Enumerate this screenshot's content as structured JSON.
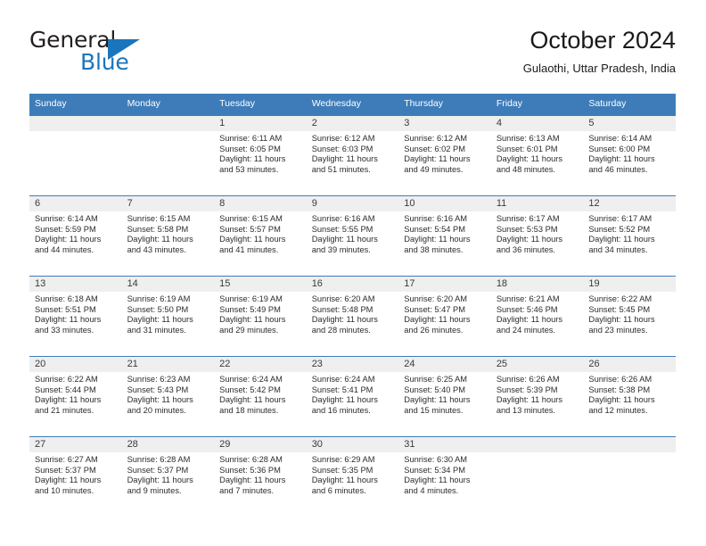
{
  "brand": {
    "name_part1": "General",
    "name_part2": "Blue",
    "accent_color": "#1b75bc"
  },
  "header": {
    "title": "October 2024",
    "subtitle": "Gulaothi, Uttar Pradesh, India"
  },
  "calendar": {
    "header_color": "#3e7cb9",
    "daynum_band_color": "#efefef",
    "weekday_headers": [
      "Sunday",
      "Monday",
      "Tuesday",
      "Wednesday",
      "Thursday",
      "Friday",
      "Saturday"
    ],
    "weeks": [
      [
        {
          "day": "",
          "sunrise": "",
          "sunset": "",
          "daylight_line1": "",
          "daylight_line2": ""
        },
        {
          "day": "",
          "sunrise": "",
          "sunset": "",
          "daylight_line1": "",
          "daylight_line2": ""
        },
        {
          "day": "1",
          "sunrise": "Sunrise: 6:11 AM",
          "sunset": "Sunset: 6:05 PM",
          "daylight_line1": "Daylight: 11 hours",
          "daylight_line2": "and 53 minutes."
        },
        {
          "day": "2",
          "sunrise": "Sunrise: 6:12 AM",
          "sunset": "Sunset: 6:03 PM",
          "daylight_line1": "Daylight: 11 hours",
          "daylight_line2": "and 51 minutes."
        },
        {
          "day": "3",
          "sunrise": "Sunrise: 6:12 AM",
          "sunset": "Sunset: 6:02 PM",
          "daylight_line1": "Daylight: 11 hours",
          "daylight_line2": "and 49 minutes."
        },
        {
          "day": "4",
          "sunrise": "Sunrise: 6:13 AM",
          "sunset": "Sunset: 6:01 PM",
          "daylight_line1": "Daylight: 11 hours",
          "daylight_line2": "and 48 minutes."
        },
        {
          "day": "5",
          "sunrise": "Sunrise: 6:14 AM",
          "sunset": "Sunset: 6:00 PM",
          "daylight_line1": "Daylight: 11 hours",
          "daylight_line2": "and 46 minutes."
        }
      ],
      [
        {
          "day": "6",
          "sunrise": "Sunrise: 6:14 AM",
          "sunset": "Sunset: 5:59 PM",
          "daylight_line1": "Daylight: 11 hours",
          "daylight_line2": "and 44 minutes."
        },
        {
          "day": "7",
          "sunrise": "Sunrise: 6:15 AM",
          "sunset": "Sunset: 5:58 PM",
          "daylight_line1": "Daylight: 11 hours",
          "daylight_line2": "and 43 minutes."
        },
        {
          "day": "8",
          "sunrise": "Sunrise: 6:15 AM",
          "sunset": "Sunset: 5:57 PM",
          "daylight_line1": "Daylight: 11 hours",
          "daylight_line2": "and 41 minutes."
        },
        {
          "day": "9",
          "sunrise": "Sunrise: 6:16 AM",
          "sunset": "Sunset: 5:55 PM",
          "daylight_line1": "Daylight: 11 hours",
          "daylight_line2": "and 39 minutes."
        },
        {
          "day": "10",
          "sunrise": "Sunrise: 6:16 AM",
          "sunset": "Sunset: 5:54 PM",
          "daylight_line1": "Daylight: 11 hours",
          "daylight_line2": "and 38 minutes."
        },
        {
          "day": "11",
          "sunrise": "Sunrise: 6:17 AM",
          "sunset": "Sunset: 5:53 PM",
          "daylight_line1": "Daylight: 11 hours",
          "daylight_line2": "and 36 minutes."
        },
        {
          "day": "12",
          "sunrise": "Sunrise: 6:17 AM",
          "sunset": "Sunset: 5:52 PM",
          "daylight_line1": "Daylight: 11 hours",
          "daylight_line2": "and 34 minutes."
        }
      ],
      [
        {
          "day": "13",
          "sunrise": "Sunrise: 6:18 AM",
          "sunset": "Sunset: 5:51 PM",
          "daylight_line1": "Daylight: 11 hours",
          "daylight_line2": "and 33 minutes."
        },
        {
          "day": "14",
          "sunrise": "Sunrise: 6:19 AM",
          "sunset": "Sunset: 5:50 PM",
          "daylight_line1": "Daylight: 11 hours",
          "daylight_line2": "and 31 minutes."
        },
        {
          "day": "15",
          "sunrise": "Sunrise: 6:19 AM",
          "sunset": "Sunset: 5:49 PM",
          "daylight_line1": "Daylight: 11 hours",
          "daylight_line2": "and 29 minutes."
        },
        {
          "day": "16",
          "sunrise": "Sunrise: 6:20 AM",
          "sunset": "Sunset: 5:48 PM",
          "daylight_line1": "Daylight: 11 hours",
          "daylight_line2": "and 28 minutes."
        },
        {
          "day": "17",
          "sunrise": "Sunrise: 6:20 AM",
          "sunset": "Sunset: 5:47 PM",
          "daylight_line1": "Daylight: 11 hours",
          "daylight_line2": "and 26 minutes."
        },
        {
          "day": "18",
          "sunrise": "Sunrise: 6:21 AM",
          "sunset": "Sunset: 5:46 PM",
          "daylight_line1": "Daylight: 11 hours",
          "daylight_line2": "and 24 minutes."
        },
        {
          "day": "19",
          "sunrise": "Sunrise: 6:22 AM",
          "sunset": "Sunset: 5:45 PM",
          "daylight_line1": "Daylight: 11 hours",
          "daylight_line2": "and 23 minutes."
        }
      ],
      [
        {
          "day": "20",
          "sunrise": "Sunrise: 6:22 AM",
          "sunset": "Sunset: 5:44 PM",
          "daylight_line1": "Daylight: 11 hours",
          "daylight_line2": "and 21 minutes."
        },
        {
          "day": "21",
          "sunrise": "Sunrise: 6:23 AM",
          "sunset": "Sunset: 5:43 PM",
          "daylight_line1": "Daylight: 11 hours",
          "daylight_line2": "and 20 minutes."
        },
        {
          "day": "22",
          "sunrise": "Sunrise: 6:24 AM",
          "sunset": "Sunset: 5:42 PM",
          "daylight_line1": "Daylight: 11 hours",
          "daylight_line2": "and 18 minutes."
        },
        {
          "day": "23",
          "sunrise": "Sunrise: 6:24 AM",
          "sunset": "Sunset: 5:41 PM",
          "daylight_line1": "Daylight: 11 hours",
          "daylight_line2": "and 16 minutes."
        },
        {
          "day": "24",
          "sunrise": "Sunrise: 6:25 AM",
          "sunset": "Sunset: 5:40 PM",
          "daylight_line1": "Daylight: 11 hours",
          "daylight_line2": "and 15 minutes."
        },
        {
          "day": "25",
          "sunrise": "Sunrise: 6:26 AM",
          "sunset": "Sunset: 5:39 PM",
          "daylight_line1": "Daylight: 11 hours",
          "daylight_line2": "and 13 minutes."
        },
        {
          "day": "26",
          "sunrise": "Sunrise: 6:26 AM",
          "sunset": "Sunset: 5:38 PM",
          "daylight_line1": "Daylight: 11 hours",
          "daylight_line2": "and 12 minutes."
        }
      ],
      [
        {
          "day": "27",
          "sunrise": "Sunrise: 6:27 AM",
          "sunset": "Sunset: 5:37 PM",
          "daylight_line1": "Daylight: 11 hours",
          "daylight_line2": "and 10 minutes."
        },
        {
          "day": "28",
          "sunrise": "Sunrise: 6:28 AM",
          "sunset": "Sunset: 5:37 PM",
          "daylight_line1": "Daylight: 11 hours",
          "daylight_line2": "and 9 minutes."
        },
        {
          "day": "29",
          "sunrise": "Sunrise: 6:28 AM",
          "sunset": "Sunset: 5:36 PM",
          "daylight_line1": "Daylight: 11 hours",
          "daylight_line2": "and 7 minutes."
        },
        {
          "day": "30",
          "sunrise": "Sunrise: 6:29 AM",
          "sunset": "Sunset: 5:35 PM",
          "daylight_line1": "Daylight: 11 hours",
          "daylight_line2": "and 6 minutes."
        },
        {
          "day": "31",
          "sunrise": "Sunrise: 6:30 AM",
          "sunset": "Sunset: 5:34 PM",
          "daylight_line1": "Daylight: 11 hours",
          "daylight_line2": "and 4 minutes."
        },
        {
          "day": "",
          "sunrise": "",
          "sunset": "",
          "daylight_line1": "",
          "daylight_line2": ""
        },
        {
          "day": "",
          "sunrise": "",
          "sunset": "",
          "daylight_line1": "",
          "daylight_line2": ""
        }
      ]
    ]
  }
}
